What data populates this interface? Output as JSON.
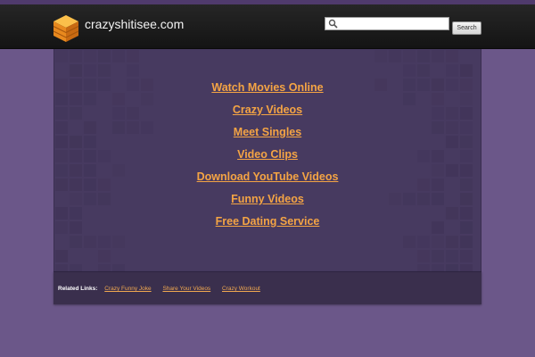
{
  "header": {
    "site_name": "crazyshitisee.com",
    "logo_icon": "orange-stacked-boxes-icon",
    "search": {
      "placeholder": "",
      "button_label": "Search",
      "icon": "search-icon"
    }
  },
  "main": {
    "links": [
      {
        "label": "Watch Movies Online"
      },
      {
        "label": "Crazy Videos"
      },
      {
        "label": "Meet Singles"
      },
      {
        "label": "Video Clips"
      },
      {
        "label": "Download YouTube Videos"
      },
      {
        "label": "Funny Videos"
      },
      {
        "label": "Free Dating Service"
      }
    ]
  },
  "footer": {
    "related_label": "Related Links:",
    "links": [
      {
        "label": "Crazy Funny Joke"
      },
      {
        "label": "Share Your Videos"
      },
      {
        "label": "Crazy Workout"
      }
    ]
  },
  "colors": {
    "background": "#6b5789",
    "header": "#1c1c1c",
    "panel": "#473a60",
    "link": "#f4a444",
    "footer": "#3a2f4d"
  }
}
